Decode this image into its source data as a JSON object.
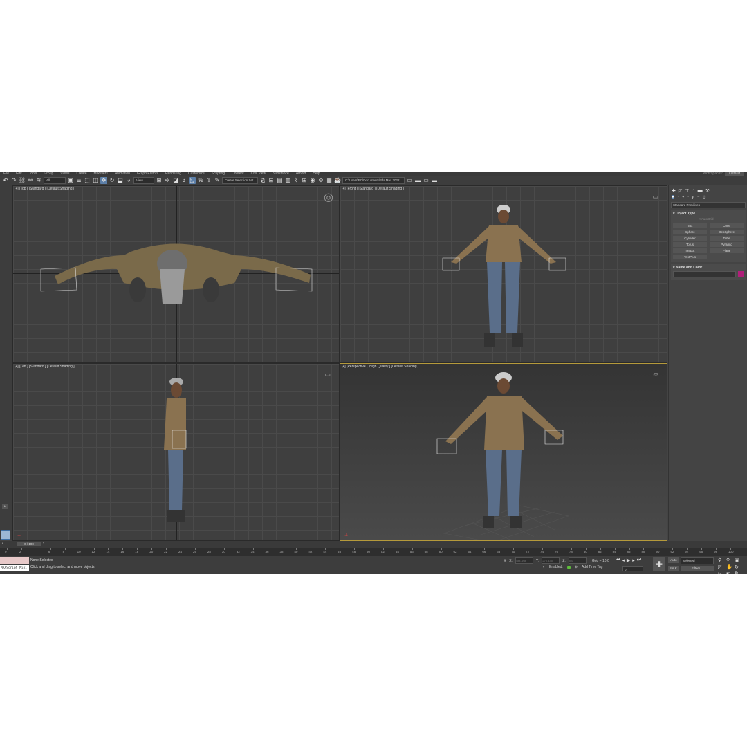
{
  "menu": [
    "File",
    "Edit",
    "Tools",
    "Group",
    "Views",
    "Create",
    "Modifiers",
    "Animation",
    "Graph Editors",
    "Rendering",
    "Customize",
    "Scripting",
    "Content",
    "Civil View",
    "Substance",
    "Arnold",
    "Help"
  ],
  "workspace": {
    "label": "Workspaces:",
    "value": "Default"
  },
  "toolbar": {
    "filter": "All",
    "view": "View",
    "selection_set": "Create Selection Set",
    "path": "C:\\Users\\PC\\Documents\\3ds Max 2022"
  },
  "viewports": {
    "top": "[+] [Top ] [Standard ] [Default Shading ]",
    "front": "[+] [Front ] [Standard ] [Default Shading ]",
    "left": "[+] [Left ] [Standard ] [Default Shading ]",
    "perspective": "[+] [Perspective ] [High Quality ] [Default Shading ]"
  },
  "command_panel": {
    "category": "Standard Primitives",
    "object_type_title": "Object Type",
    "autogrid": "AutoGrid",
    "buttons": [
      "Box",
      "Cone",
      "Sphere",
      "GeoSphere",
      "Cylinder",
      "Tube",
      "Torus",
      "Pyramid",
      "Teapot",
      "Plane",
      "TextPlus"
    ],
    "name_color_title": "Name and Color",
    "color": "#b01f7a"
  },
  "timeline": {
    "slider": "0 / 100",
    "ticks": [
      "0",
      "2",
      "6",
      "8",
      "10",
      "12",
      "14",
      "16",
      "18",
      "20",
      "22",
      "24",
      "26",
      "28",
      "30",
      "32",
      "34",
      "36",
      "38",
      "40",
      "42",
      "44",
      "46",
      "48",
      "50",
      "52",
      "54",
      "56",
      "58",
      "60",
      "62",
      "64",
      "66",
      "68",
      "70",
      "72",
      "74",
      "76",
      "78",
      "80",
      "82",
      "84",
      "86",
      "88",
      "90",
      "92",
      "94",
      "96",
      "98",
      "100"
    ]
  },
  "status": {
    "selection": "None Selected",
    "prompt": "Click and drag to select and move objects",
    "maxscript": "MAXScript Mini",
    "x_label": "X:",
    "x_value": "484,498",
    "y_label": "Y:",
    "y_value": "270,435",
    "z_label": "Z:",
    "z_value": "0,0",
    "grid": "Grid = 10,0",
    "enabled": "Enabled:",
    "add_time_tag": "Add Time Tag",
    "frame": "0",
    "auto": "Auto",
    "selected": "Selected",
    "setk": "Set K.",
    "filters": "Filters..."
  }
}
